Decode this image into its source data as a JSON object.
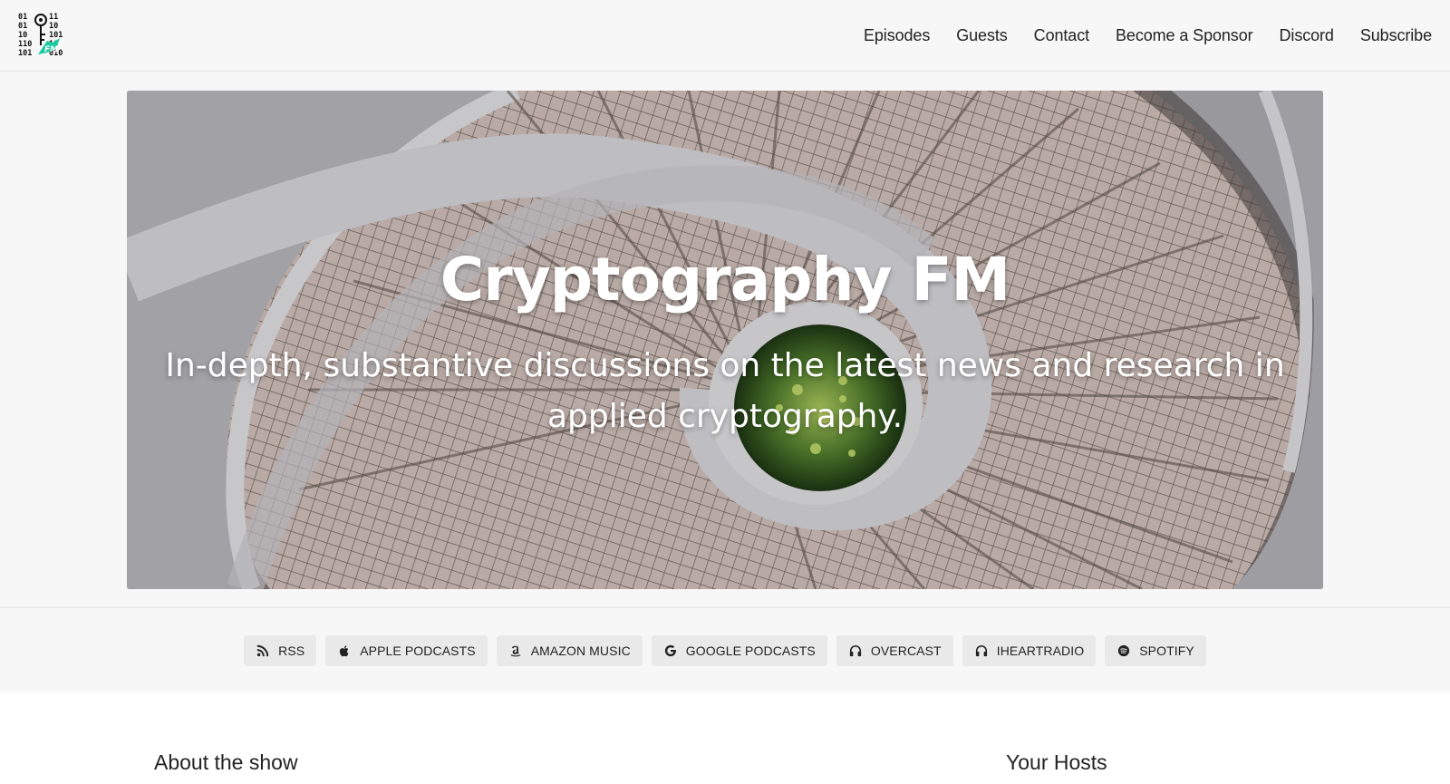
{
  "site": {
    "logo_icon": "cryptography-fm-logo",
    "accent_color": "#19c9a0"
  },
  "nav": {
    "items": [
      {
        "label": "Episodes"
      },
      {
        "label": "Guests"
      },
      {
        "label": "Contact"
      },
      {
        "label": "Become a Sponsor"
      },
      {
        "label": "Discord"
      },
      {
        "label": "Subscribe"
      }
    ]
  },
  "hero": {
    "title": "Cryptography FM",
    "subtitle": "In-depth, substantive discussions on the latest news and research in applied cryptography.",
    "image": "spiral-staircase-photo"
  },
  "subscribe": {
    "buttons": [
      {
        "label": "RSS",
        "icon": "rss-icon"
      },
      {
        "label": "APPLE PODCASTS",
        "icon": "apple-icon"
      },
      {
        "label": "AMAZON MUSIC",
        "icon": "amazon-icon"
      },
      {
        "label": "GOOGLE PODCASTS",
        "icon": "google-icon"
      },
      {
        "label": "OVERCAST",
        "icon": "headphones-icon"
      },
      {
        "label": "IHEARTRADIO",
        "icon": "headphones-icon"
      },
      {
        "label": "SPOTIFY",
        "icon": "spotify-icon"
      }
    ]
  },
  "sections": {
    "about_heading": "About the show",
    "hosts_heading": "Your Hosts"
  }
}
